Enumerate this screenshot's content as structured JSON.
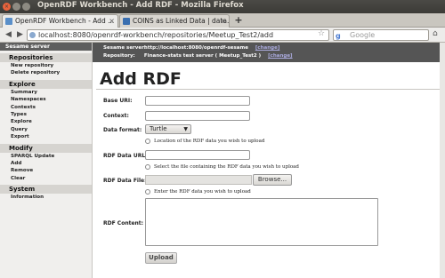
{
  "window": {
    "title": "OpenRDF Workbench - Add RDF - Mozilla Firefox"
  },
  "tabs": [
    {
      "label": "OpenRDF Workbench - Add ..."
    },
    {
      "label": "COINS as Linked Data | data..."
    }
  ],
  "nav": {
    "url": "localhost:8080/openrdf-workbench/repositories/Meetup_Test2/add",
    "search_placeholder": "Google"
  },
  "sidebar": {
    "server_label": "Sesame server",
    "sections": [
      {
        "title": "Repositories",
        "items": [
          "New repository",
          "Delete repository"
        ]
      },
      {
        "title": "Explore",
        "items": [
          "Summary",
          "Namespaces",
          "Contexts",
          "Types",
          "Explore",
          "Query",
          "Export"
        ]
      },
      {
        "title": "Modify",
        "items": [
          "SPARQL Update",
          "Add",
          "Remove",
          "Clear"
        ]
      },
      {
        "title": "System",
        "items": [
          "Information"
        ]
      }
    ]
  },
  "server_info": {
    "server_label": "Sesame server:",
    "server_value": "http://localhost:8080/openrdf-sesame",
    "repo_label": "Repository:",
    "repo_value": "Finance-stats test server ( Meetup_Test2 )",
    "change_label": "[change]"
  },
  "main": {
    "title": "Add RDF",
    "base_uri_label": "Base URI:",
    "context_label": "Context:",
    "data_format_label": "Data format:",
    "data_format_value": "Turtle",
    "radio_url_label": "Location of the RDF data you wish to upload",
    "rdf_url_label": "RDF Data URL:",
    "radio_file_label": "Select the file containing the RDF data you wish to upload",
    "rdf_file_label": "RDF Data File:",
    "browse_label": "Browse...",
    "radio_content_label": "Enter the RDF data you wish to upload",
    "rdf_content_label": "RDF Content:",
    "upload_label": "Upload"
  }
}
